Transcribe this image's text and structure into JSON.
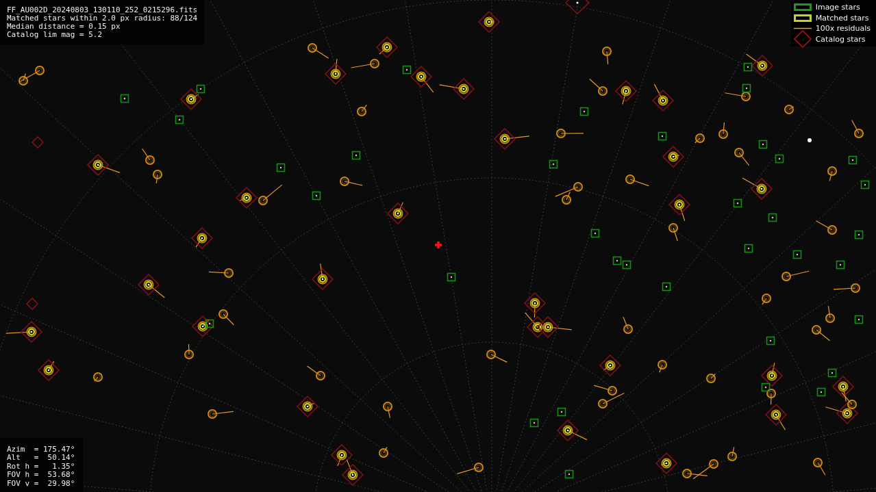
{
  "info": {
    "lines": [
      "FF_AU002D_20240803_130110_252_0215296.fits",
      "Matched stars within 2.0 px radius: 88/124",
      "Median distance = 0.15 px",
      "Catalog lim mag = 5.2"
    ]
  },
  "legend": [
    {
      "kind": "image",
      "label": "Image stars"
    },
    {
      "kind": "matched",
      "label": "Matched stars"
    },
    {
      "kind": "residual",
      "label": "100x residuals"
    },
    {
      "kind": "catalog",
      "label": "Catalog stars"
    }
  ],
  "pointing": {
    "lines": [
      "Azim  = 175.47°",
      "Alt   =  50.14°",
      "Rot h =   1.35°",
      "FOV h =  53.68°",
      "FOV v =  29.98°"
    ]
  }
}
